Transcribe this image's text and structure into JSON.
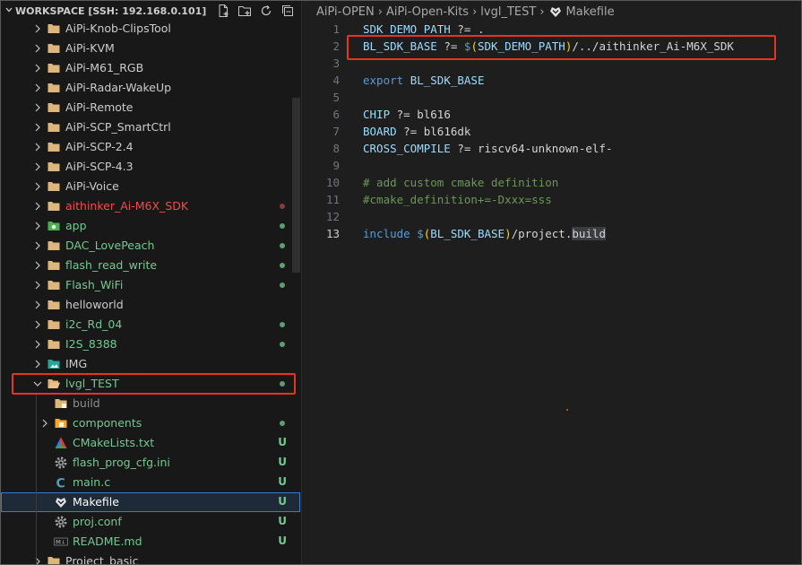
{
  "sidebar": {
    "title": "WORKSPACE [SSH: 192.168.0.101]",
    "actions": [
      {
        "name": "new-file-icon"
      },
      {
        "name": "new-folder-icon"
      },
      {
        "name": "refresh-icon"
      },
      {
        "name": "collapse-all-icon"
      }
    ],
    "items": [
      {
        "label": "AiPi-Knob-ClipsTool",
        "status": ""
      },
      {
        "label": "AiPi-KVM",
        "status": ""
      },
      {
        "label": "AiPi-M61_RGB",
        "status": ""
      },
      {
        "label": "AiPi-Radar-WakeUp",
        "status": ""
      },
      {
        "label": "AiPi-Remote",
        "status": ""
      },
      {
        "label": "AiPi-SCP_SmartCtrl",
        "status": ""
      },
      {
        "label": "AiPi-SCP-2.4",
        "status": ""
      },
      {
        "label": "AiPi-SCP-4.3",
        "status": ""
      },
      {
        "label": "AiPi-Voice",
        "status": ""
      },
      {
        "label": "aithinker_Ai-M6X_SDK",
        "status": ""
      },
      {
        "label": "app",
        "status": ""
      },
      {
        "label": "DAC_LovePeach",
        "status": ""
      },
      {
        "label": "flash_read_write",
        "status": ""
      },
      {
        "label": "Flash_WiFi",
        "status": ""
      },
      {
        "label": "helloworld",
        "status": ""
      },
      {
        "label": "i2c_Rd_04",
        "status": ""
      },
      {
        "label": "I2S_8388",
        "status": ""
      },
      {
        "label": "IMG",
        "status": ""
      },
      {
        "label": "lvgl_TEST",
        "status": ""
      },
      {
        "label": "build",
        "status": ""
      },
      {
        "label": "components",
        "status": ""
      },
      {
        "label": "CMakeLists.txt",
        "status": "U"
      },
      {
        "label": "flash_prog_cfg.ini",
        "status": "U"
      },
      {
        "label": "main.c",
        "status": "U"
      },
      {
        "label": "Makefile",
        "status": "U"
      },
      {
        "label": "proj.conf",
        "status": "U"
      },
      {
        "label": "README.md",
        "status": "U"
      },
      {
        "label": "Project_basic",
        "status": ""
      }
    ]
  },
  "breadcrumb": {
    "items": [
      "AiPi-OPEN",
      "AiPi-Open-Kits",
      "lvgl_TEST",
      "Makefile"
    ]
  },
  "editor": {
    "line_numbers": [
      "1",
      "2",
      "3",
      "4",
      "5",
      "6",
      "7",
      "8",
      "9",
      "10",
      "11",
      "12",
      "13"
    ],
    "lines": [
      {
        "n": "1",
        "t1": "SDK_DEMO_PATH",
        " t2": "",
        "op": " ?= ",
        "val": "."
      },
      {
        "n": "2"
      },
      {
        "n": "3"
      }
    ],
    "l1": {
      "a": "SDK_DEMO_PATH",
      "b": " ?= ",
      "c": "."
    },
    "l2": {
      "a": "BL_SDK_BASE",
      "b": " ?= ",
      "c": "$",
      "d": "(",
      "e": "SDK_DEMO_PATH",
      "f": ")",
      "g": "/../aithinker_Ai-M6X_SDK"
    },
    "l4": {
      "a": "export",
      "b": " ",
      "c": "BL_SDK_BASE"
    },
    "l6": {
      "a": "CHIP",
      "b": " ?= ",
      "c": "bl616"
    },
    "l7": {
      "a": "BOARD",
      "b": " ?= ",
      "c": "bl616dk"
    },
    "l8": {
      "a": "CROSS_COMPILE",
      "b": " ?= ",
      "c": "riscv64-unknown-elf-"
    },
    "l10": {
      "a": "# add custom cmake definition"
    },
    "l11": {
      "a": "#cmake_definition+=-Dxxx=sss"
    },
    "l13": {
      "a": "include",
      "b": " ",
      "c": "$",
      "d": "(",
      "e": "BL_SDK_BASE",
      "f": ")",
      "g": "/project.",
      "h": "build"
    }
  },
  "colors": {
    "accent_red": "#e8341c",
    "git_untracked": "#73c991",
    "git_modified": "#f14c4c"
  }
}
